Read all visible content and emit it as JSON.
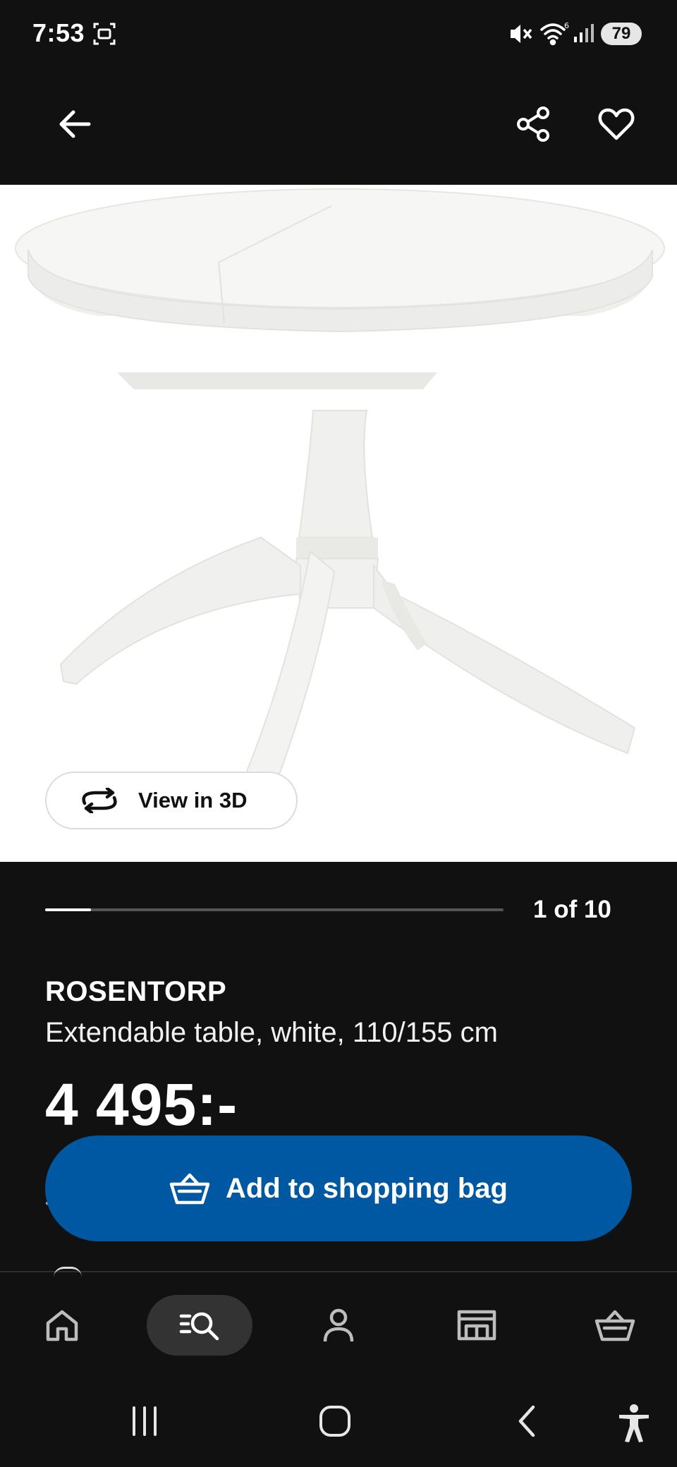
{
  "status_bar": {
    "time": "7:53",
    "battery": "79"
  },
  "top_bar": {
    "icons": [
      "back-arrow-icon",
      "share-icon",
      "heart-icon"
    ]
  },
  "gallery": {
    "view_3d_label": "View in 3D",
    "counter": "1 of 10",
    "current_index": 1,
    "total": 10
  },
  "product": {
    "name": "ROSENTORP",
    "description": "Extendable table, white, 110/155 cm",
    "price": "4 495:-"
  },
  "actions": {
    "add_to_bag_label": "Add to shopping bag"
  },
  "bottom_nav": {
    "items": [
      "home-icon",
      "search-icon",
      "profile-icon",
      "stores-icon",
      "bag-icon"
    ],
    "active": "search-icon"
  },
  "colors": {
    "background": "#111111",
    "accent_blue": "#0058a3",
    "text": "#ffffff"
  }
}
